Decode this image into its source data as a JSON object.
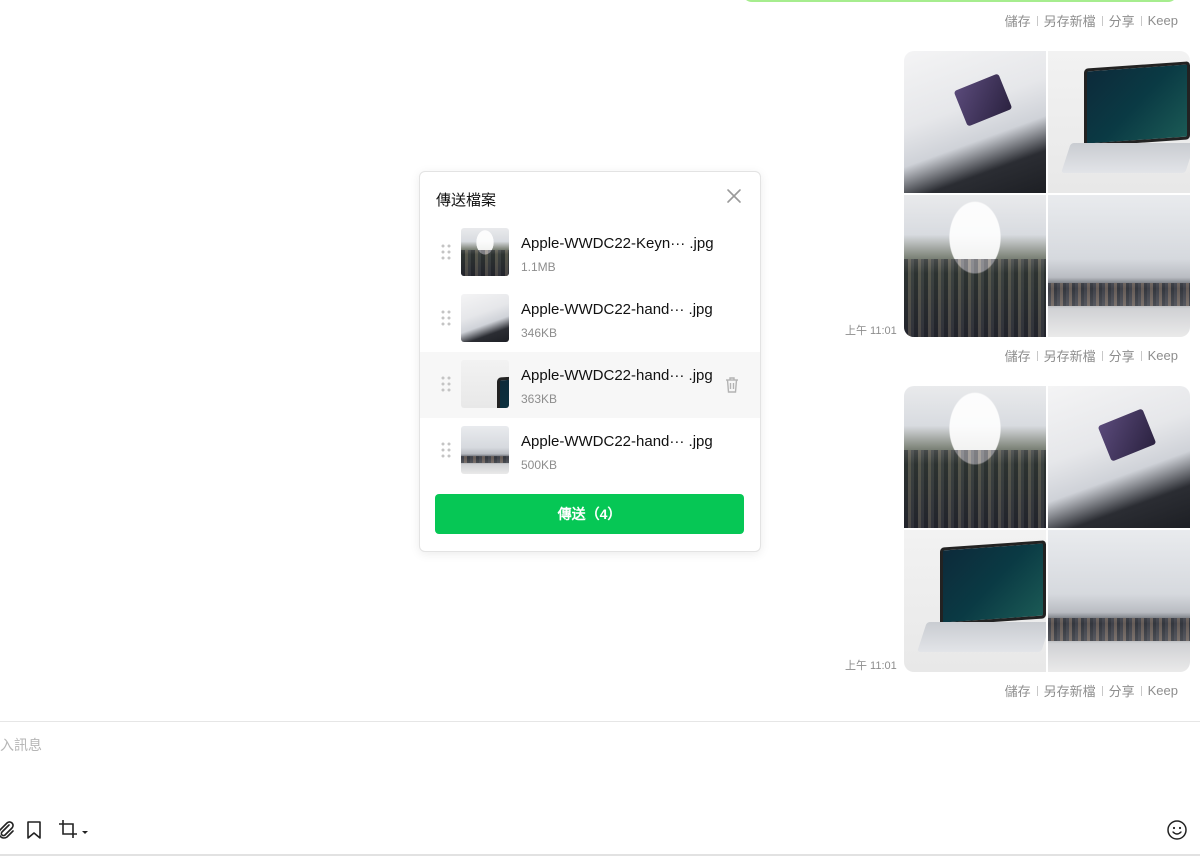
{
  "chat": {
    "top_actions": [
      "儲存",
      "另存新檔",
      "分享",
      "Keep"
    ],
    "messages": [
      {
        "time": "上午 11:01",
        "photos": [
          "hand-holding-macbook",
          "laptop-keynote",
          "crowd-auditorium",
          "wide-crowd"
        ],
        "actions": [
          "儲存",
          "另存新檔",
          "分享",
          "Keep"
        ]
      },
      {
        "time": "上午 11:01",
        "photos": [
          "crowd-auditorium",
          "hand-holding-macbook",
          "laptop-keynote",
          "wide-crowd"
        ],
        "actions": [
          "儲存",
          "另存新檔",
          "分享",
          "Keep"
        ]
      }
    ]
  },
  "modal": {
    "title": "傳送檔案",
    "close_icon": "close-icon",
    "files": [
      {
        "name": "Apple-WWDC22-Keyn··· .jpg",
        "size": "1.1MB",
        "thumb": "crowd"
      },
      {
        "name": "Apple-WWDC22-hand··· .jpg",
        "size": "346KB",
        "thumb": "hand"
      },
      {
        "name": "Apple-WWDC22-hand··· .jpg",
        "size": "363KB",
        "thumb": "laptop"
      },
      {
        "name": "Apple-WWDC22-hand··· .jpg",
        "size": "500KB",
        "thumb": "wide"
      }
    ],
    "send_label": "傳送（4）",
    "accent": "#06c755"
  },
  "input": {
    "placeholder": "入訊息"
  },
  "toolbar": {
    "icons": [
      "paperclip-icon",
      "bookmark-icon",
      "crop-icon",
      "emoji-icon"
    ]
  },
  "colors": {
    "bubble_green": "#a6ed8e",
    "muted_text": "#8d8d8d",
    "send_green": "#06c755"
  }
}
